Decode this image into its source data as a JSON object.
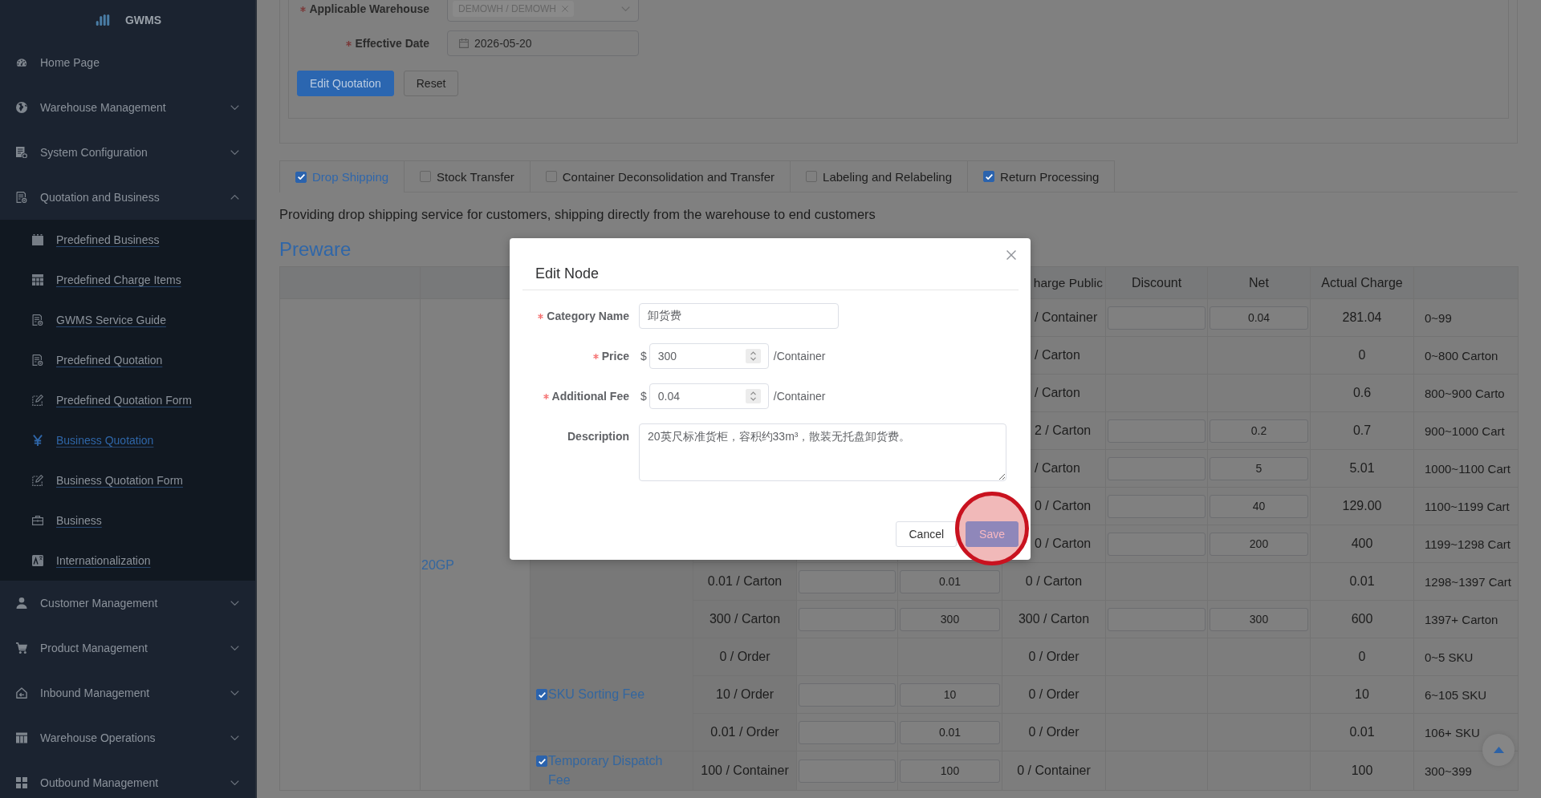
{
  "sidebar": {
    "logo": "GWMS",
    "items": [
      {
        "label": "Home Page",
        "kind": "link"
      },
      {
        "label": "Warehouse Management",
        "kind": "group",
        "expanded": false
      },
      {
        "label": "System Configuration",
        "kind": "group",
        "expanded": false
      },
      {
        "label": "Quotation and Business",
        "kind": "group",
        "expanded": true,
        "children": [
          {
            "label": "Predefined Business",
            "selected": false
          },
          {
            "label": "Predefined Charge Items",
            "selected": false
          },
          {
            "label": "GWMS Service Guide",
            "selected": false
          },
          {
            "label": "Predefined Quotation",
            "selected": false
          },
          {
            "label": "Predefined Quotation Form",
            "selected": false
          },
          {
            "label": "Business Quotation",
            "selected": true
          },
          {
            "label": "Business Quotation Form",
            "selected": false
          },
          {
            "label": "Business",
            "selected": false
          },
          {
            "label": "Internationalization",
            "selected": false
          }
        ]
      },
      {
        "label": "Customer Management",
        "kind": "group",
        "expanded": false
      },
      {
        "label": "Product Management",
        "kind": "group",
        "expanded": false
      },
      {
        "label": "Inbound Management",
        "kind": "group",
        "expanded": false
      },
      {
        "label": "Warehouse Operations",
        "kind": "group",
        "expanded": false
      },
      {
        "label": "Outbound Management",
        "kind": "group",
        "expanded": false
      }
    ]
  },
  "form": {
    "fields": [
      {
        "label": "Applicable Warehouse",
        "required": true,
        "kind": "select",
        "tags": [
          "DEMOWH / DEMOWH"
        ]
      },
      {
        "label": "Effective Date",
        "required": true,
        "kind": "date",
        "value": "2026-05-20"
      }
    ],
    "buttons": [
      {
        "label": "Edit Quotation",
        "kind": "primary"
      },
      {
        "label": "Reset",
        "kind": "default"
      }
    ]
  },
  "tabs": [
    {
      "label": "Drop Shipping",
      "checked": true,
      "selected": true
    },
    {
      "label": "Stock Transfer",
      "checked": false,
      "selected": false
    },
    {
      "label": "Container Deconsolidation and Transfer",
      "checked": false,
      "selected": false
    },
    {
      "label": "Labeling and Relabeling",
      "checked": false,
      "selected": false
    },
    {
      "label": "Return Processing",
      "checked": true,
      "selected": false
    }
  ],
  "description": "Providing drop shipping service for customers, shipping directly from the warehouse to end customers",
  "section_title": "Preware",
  "table": {
    "columns": [
      "harge Public",
      "Discount",
      "Net",
      "Actual Charge"
    ],
    "container": "20GP",
    "groups": [
      {
        "rows": [
          {
            "cells": [
              {
                "kind": "blank"
              },
              {
                "kind": "blank"
              },
              {
                "kind": "blank"
              },
              {
                "kind": "clipped",
                "text": "/ Container"
              },
              {
                "kind": "field"
              },
              {
                "kind": "field",
                "value": "0.04"
              },
              {
                "kind": "text",
                "text": "281.04"
              },
              {
                "kind": "text",
                "text": "0~99"
              }
            ]
          },
          {
            "cells": [
              {
                "kind": "blank"
              },
              {
                "kind": "blank"
              },
              {
                "kind": "blank"
              },
              {
                "kind": "clipped",
                "text": "/ Carton"
              },
              {
                "kind": "blank"
              },
              {
                "kind": "blank"
              },
              {
                "kind": "text",
                "text": "0"
              },
              {
                "kind": "text",
                "text": "0~800 Carton"
              }
            ]
          },
          {
            "cells": [
              {
                "kind": "blank"
              },
              {
                "kind": "blank"
              },
              {
                "kind": "blank"
              },
              {
                "kind": "clipped",
                "text": "/ Carton"
              },
              {
                "kind": "blank"
              },
              {
                "kind": "blank"
              },
              {
                "kind": "text",
                "text": "0.6"
              },
              {
                "kind": "text",
                "text": "800~900 Carto"
              }
            ]
          },
          {
            "cells": [
              {
                "kind": "blank"
              },
              {
                "kind": "blank"
              },
              {
                "kind": "blank"
              },
              {
                "kind": "clipped",
                "text": "2 / Carton"
              },
              {
                "kind": "field"
              },
              {
                "kind": "field",
                "value": "0.2"
              },
              {
                "kind": "text",
                "text": "0.7"
              },
              {
                "kind": "text",
                "text": "900~1000 Cart"
              }
            ]
          },
          {
            "cells": [
              {
                "kind": "blank"
              },
              {
                "kind": "blank"
              },
              {
                "kind": "blank"
              },
              {
                "kind": "clipped",
                "text": "/ Carton"
              },
              {
                "kind": "field"
              },
              {
                "kind": "field",
                "value": "5"
              },
              {
                "kind": "text",
                "text": "5.01"
              },
              {
                "kind": "text",
                "text": "1000~1100 Cart"
              }
            ]
          },
          {
            "cells": [
              {
                "kind": "blank"
              },
              {
                "kind": "blank"
              },
              {
                "kind": "blank"
              },
              {
                "kind": "clipped",
                "text": "0 / Carton"
              },
              {
                "kind": "field"
              },
              {
                "kind": "field",
                "value": "40"
              },
              {
                "kind": "text",
                "text": "129.00"
              },
              {
                "kind": "text",
                "text": "1100~1199 Cart"
              }
            ]
          },
          {
            "cells": [
              {
                "kind": "blank"
              },
              {
                "kind": "blank"
              },
              {
                "kind": "blank"
              },
              {
                "kind": "clipped",
                "text": "0 / Carton"
              },
              {
                "kind": "field"
              },
              {
                "kind": "field",
                "value": "200"
              },
              {
                "kind": "text",
                "text": "400"
              },
              {
                "kind": "text",
                "text": "1199~1298 Cart"
              }
            ]
          },
          {
            "cells": [
              {
                "kind": "text",
                "text": "0.01 / Carton"
              },
              {
                "kind": "field"
              },
              {
                "kind": "field",
                "value": "0.01"
              },
              {
                "kind": "text",
                "text": "0 / Carton"
              },
              {
                "kind": "blank"
              },
              {
                "kind": "blank"
              },
              {
                "kind": "text",
                "text": "0.01"
              },
              {
                "kind": "text",
                "text": "1298~1397 Cart"
              }
            ]
          },
          {
            "cells": [
              {
                "kind": "text",
                "text": "300 / Carton"
              },
              {
                "kind": "field"
              },
              {
                "kind": "field",
                "value": "300"
              },
              {
                "kind": "text",
                "text": "300 / Carton"
              },
              {
                "kind": "field"
              },
              {
                "kind": "field",
                "value": "300"
              },
              {
                "kind": "text",
                "text": "600"
              },
              {
                "kind": "text",
                "text": "1397+ Carton"
              }
            ]
          }
        ]
      },
      {
        "name": "SKU Sorting Fee",
        "checked": true,
        "rows": [
          {
            "cells": [
              {
                "kind": "text",
                "text": "0 / Order"
              },
              {
                "kind": "blank"
              },
              {
                "kind": "blank"
              },
              {
                "kind": "text",
                "text": "0 / Order"
              },
              {
                "kind": "blank"
              },
              {
                "kind": "blank"
              },
              {
                "kind": "text",
                "text": "0"
              },
              {
                "kind": "text",
                "text": "0~5 SKU"
              }
            ]
          },
          {
            "cells": [
              {
                "kind": "text",
                "text": "10 / Order"
              },
              {
                "kind": "field"
              },
              {
                "kind": "field",
                "value": "10"
              },
              {
                "kind": "text",
                "text": "0 / Order"
              },
              {
                "kind": "blank"
              },
              {
                "kind": "blank"
              },
              {
                "kind": "text",
                "text": "10"
              },
              {
                "kind": "text",
                "text": "6~105 SKU"
              }
            ]
          },
          {
            "cells": [
              {
                "kind": "text",
                "text": "0.01 / Order"
              },
              {
                "kind": "field"
              },
              {
                "kind": "field",
                "value": "0.01"
              },
              {
                "kind": "text",
                "text": "0 / Order"
              },
              {
                "kind": "blank"
              },
              {
                "kind": "blank"
              },
              {
                "kind": "text",
                "text": "0.01"
              },
              {
                "kind": "text",
                "text": "106+ SKU"
              }
            ]
          }
        ]
      },
      {
        "name": "Temporary Dispatch Fee",
        "checked": true,
        "rows": [
          {
            "cells": [
              {
                "kind": "text",
                "text": "100 / Container"
              },
              {
                "kind": "field"
              },
              {
                "kind": "field",
                "value": "100"
              },
              {
                "kind": "text",
                "text": "0 / Container"
              },
              {
                "kind": "blank"
              },
              {
                "kind": "blank"
              },
              {
                "kind": "text",
                "text": "100"
              },
              {
                "kind": "text",
                "text": "300~399"
              }
            ]
          }
        ]
      }
    ]
  },
  "dialog": {
    "title": "Edit Node",
    "fields": [
      {
        "label": "Category Name",
        "required": true,
        "kind": "text",
        "value": "卸货费"
      },
      {
        "label": "Price",
        "required": true,
        "kind": "number",
        "prefix": "$",
        "value": "300",
        "suffix": "/Container"
      },
      {
        "label": "Additional Fee",
        "required": true,
        "kind": "number",
        "prefix": "$",
        "value": "0.04",
        "suffix": "/Container"
      },
      {
        "label": "Description",
        "required": false,
        "kind": "textarea",
        "value": "20英尺标准货柜，容积约33m³，散装无托盘卸货费。"
      }
    ],
    "buttons": [
      {
        "label": "Cancel",
        "kind": "default",
        "highlighted": false
      },
      {
        "label": "Save",
        "kind": "primary",
        "highlighted": true
      }
    ]
  }
}
